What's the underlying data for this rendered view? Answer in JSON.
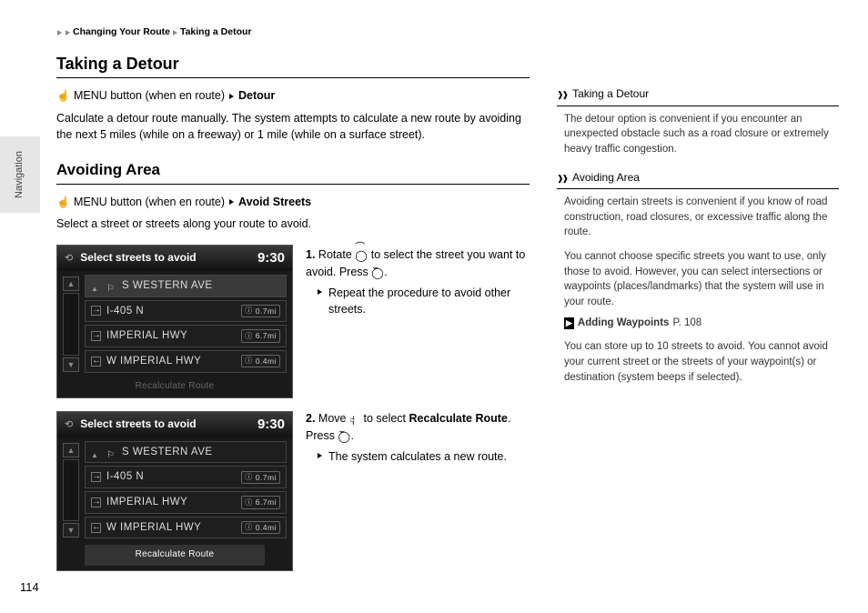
{
  "breadcrumb": {
    "a": "Changing Your Route",
    "b": "Taking a Detour"
  },
  "sideTab": "Navigation",
  "pageNum": "114",
  "s1": {
    "title": "Taking a Detour",
    "menu": "MENU button (when en route)",
    "target": "Detour",
    "desc": "Calculate a detour route manually. The system attempts to calculate a new route by avoiding the next 5 miles (while on a freeway) or 1 mile (while on a surface street)."
  },
  "s2": {
    "title": "Avoiding Area",
    "menu": "MENU button (when en route)",
    "target": "Avoid Streets",
    "desc": "Select a street or streets along your route to avoid.",
    "step1a": "Rotate",
    "step1b": "to select the street you want to avoid. Press",
    "step1sub": "Repeat the procedure to avoid other streets.",
    "step2a": "Move",
    "step2b": "to select",
    "step2c": "Recalculate Route",
    "step2d": ". Press",
    "step2sub": "The system calculates a new route."
  },
  "shot": {
    "header": "Select streets to avoid",
    "time": "9:30",
    "rows": [
      {
        "icon": "up",
        "name": "S WESTERN AVE",
        "dist": ""
      },
      {
        "icon": "r",
        "name": "I-405 N",
        "dist": "0.7mi"
      },
      {
        "icon": "r",
        "name": "IMPERIAL HWY",
        "dist": "6.7mi"
      },
      {
        "icon": "l",
        "name": "W IMPERIAL HWY",
        "dist": "0.4mi"
      }
    ],
    "footer": "Recalculate Route"
  },
  "sidebar": {
    "a": {
      "title": "Taking a Detour",
      "p1": "The detour option is convenient if you encounter an unexpected obstacle such as a road closure or extremely heavy traffic congestion."
    },
    "b": {
      "title": "Avoiding Area",
      "p1": "Avoiding certain streets is convenient if you know of road construction, road closures, or excessive traffic along the route.",
      "p2": "You cannot choose specific streets you want to use, only those to avoid. However, you can select intersections or waypoints (places/landmarks) that the system will use in your route.",
      "ref": "Adding Waypoints",
      "refPage": "P. 108",
      "p3": "You can store up to 10 streets to avoid. You cannot avoid your current street or the streets of your waypoint(s) or destination (system beeps if selected)."
    }
  }
}
